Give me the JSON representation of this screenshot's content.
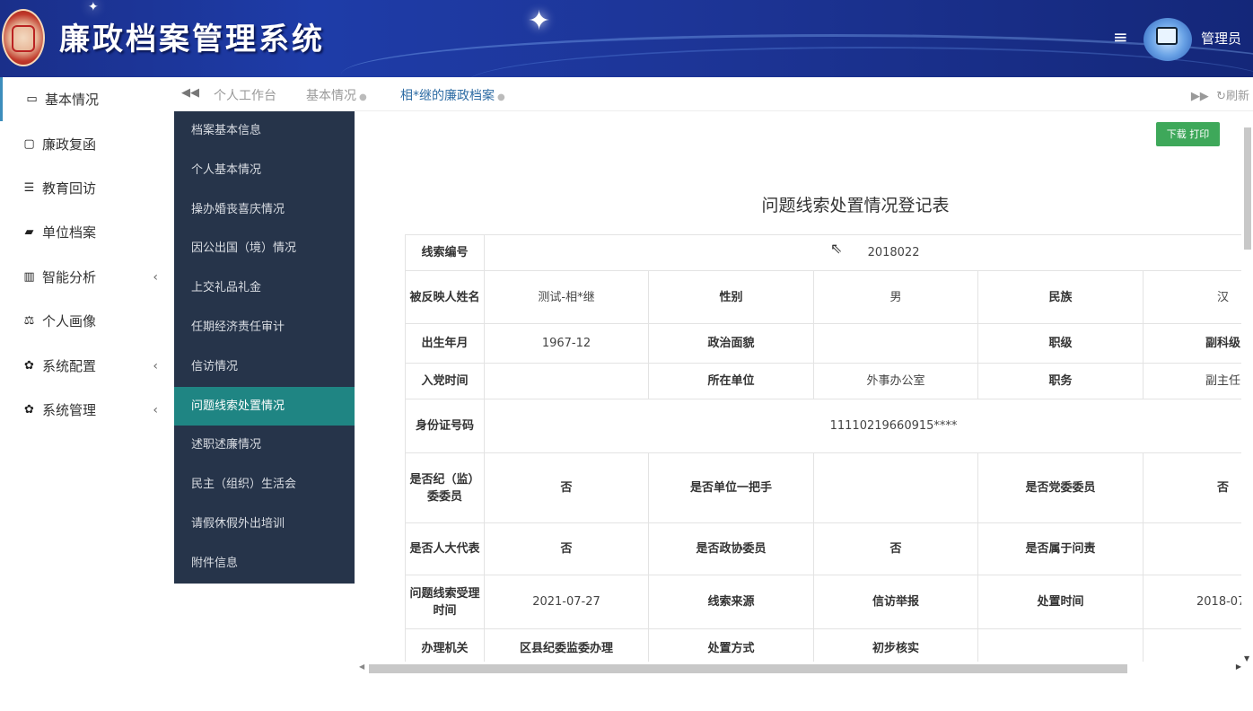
{
  "header": {
    "app_title": "廉政档案管理系统",
    "menu_icon": "hamburger-icon",
    "user_name": "管理员"
  },
  "sidebar": {
    "items": [
      {
        "label": "基本情况",
        "icon": "id-card-icon"
      },
      {
        "label": "廉政复函",
        "icon": "word-file-icon"
      },
      {
        "label": "教育回访",
        "icon": "list-icon"
      },
      {
        "label": "单位档案",
        "icon": "book-icon"
      },
      {
        "label": "智能分析",
        "icon": "bar-chart-icon"
      },
      {
        "label": "个人画像",
        "icon": "balance-scale-icon"
      },
      {
        "label": "系统配置",
        "icon": "gear-icon"
      },
      {
        "label": "系统管理",
        "icon": "gear-icon"
      }
    ]
  },
  "tabs": {
    "items": [
      {
        "label": "个人工作台"
      },
      {
        "label": "基本情况"
      },
      {
        "label": "相*继的廉政档案"
      }
    ],
    "refresh_label": "刷新"
  },
  "submenu": {
    "items": [
      "档案基本信息",
      "个人基本情况",
      "操办婚丧喜庆情况",
      "因公出国（境）情况",
      "上交礼品礼金",
      "任期经济责任审计",
      "信访情况",
      "问题线索处置情况",
      "述职述廉情况",
      "民主（组织）生活会",
      "请假休假外出培训",
      "附件信息"
    ]
  },
  "content": {
    "download_button": "下载 打印",
    "form_title": "问题线索处置情况登记表",
    "labels": {
      "clue_no": "线索编号",
      "name": "被反映人姓名",
      "gender": "性别",
      "ethnicity": "民族",
      "birth": "出生年月",
      "political": "政治面貌",
      "rank": "职级",
      "join_party": "入党时间",
      "unit": "所在单位",
      "position": "职务",
      "id_no": "身份证号码",
      "discipline_member": "是否纪（监）委委员",
      "unit_head": "是否单位一把手",
      "party_committee": "是否党委委员",
      "npc_rep": "是否人大代表",
      "cppcc": "是否政协委员",
      "accountability": "是否属于问责",
      "accept_time": "问题线索受理时间",
      "source": "线索来源",
      "handle_time": "处置时间",
      "handling_org": "办理机关",
      "method": "处置方式"
    },
    "values": {
      "clue_no": "2018022",
      "name": "测试-相*继",
      "gender": "男",
      "ethnicity": "汉",
      "birth": "1967-12",
      "political": "",
      "rank": "副科级",
      "join_party": "",
      "unit": "外事办公室",
      "position": "副主任",
      "id_no": "11110219660915****",
      "discipline_member": "否",
      "unit_head": "",
      "party_committee": "否",
      "npc_rep": "否",
      "cppcc": "否",
      "accountability": "",
      "accept_time": "2021-07-27",
      "source": "信访举报",
      "handle_time": "2018-07-",
      "handling_org": "区县纪委监委办理",
      "method": "初步核实"
    }
  }
}
